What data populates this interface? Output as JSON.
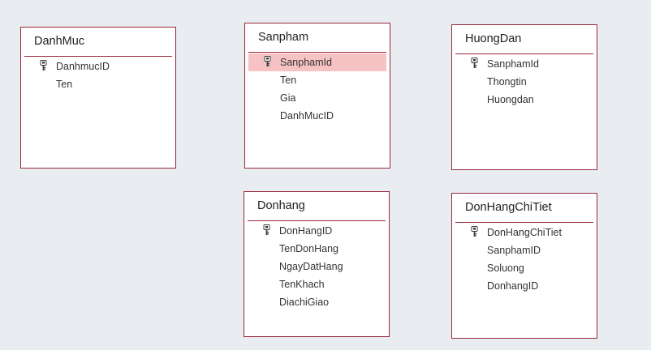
{
  "tables": [
    {
      "id": "danhmuc",
      "name": "DanhMuc",
      "fields": [
        {
          "label": "DanhmucID",
          "key": true,
          "selected": false
        },
        {
          "label": "Ten",
          "key": false,
          "selected": false
        }
      ]
    },
    {
      "id": "sanpham",
      "name": "Sanpham",
      "fields": [
        {
          "label": "SanphamId",
          "key": true,
          "selected": true
        },
        {
          "label": "Ten",
          "key": false,
          "selected": false
        },
        {
          "label": "Gia",
          "key": false,
          "selected": false
        },
        {
          "label": "DanhMucID",
          "key": false,
          "selected": false
        }
      ]
    },
    {
      "id": "huongdan",
      "name": "HuongDan",
      "fields": [
        {
          "label": "SanphamId",
          "key": true,
          "selected": false
        },
        {
          "label": "Thongtin",
          "key": false,
          "selected": false
        },
        {
          "label": "Huongdan",
          "key": false,
          "selected": false
        }
      ]
    },
    {
      "id": "donhang",
      "name": "Donhang",
      "fields": [
        {
          "label": "DonHangID",
          "key": true,
          "selected": false
        },
        {
          "label": "TenDonHang",
          "key": false,
          "selected": false
        },
        {
          "label": "NgayDatHang",
          "key": false,
          "selected": false
        },
        {
          "label": "TenKhach",
          "key": false,
          "selected": false
        },
        {
          "label": "DiachiGiao",
          "key": false,
          "selected": false
        }
      ]
    },
    {
      "id": "donhangchitiet",
      "name": "DonHangChiTiet",
      "fields": [
        {
          "label": "DonHangChiTiet",
          "key": true,
          "selected": false
        },
        {
          "label": "SanphamID",
          "key": false,
          "selected": false
        },
        {
          "label": "Soluong",
          "key": false,
          "selected": false
        },
        {
          "label": "DonhangID",
          "key": false,
          "selected": false
        }
      ]
    }
  ],
  "icons": {
    "primary_key": "key-icon"
  },
  "colors": {
    "background": "#e9ecf0",
    "table_border": "#98283a",
    "selected_row": "#f6c2c4"
  }
}
